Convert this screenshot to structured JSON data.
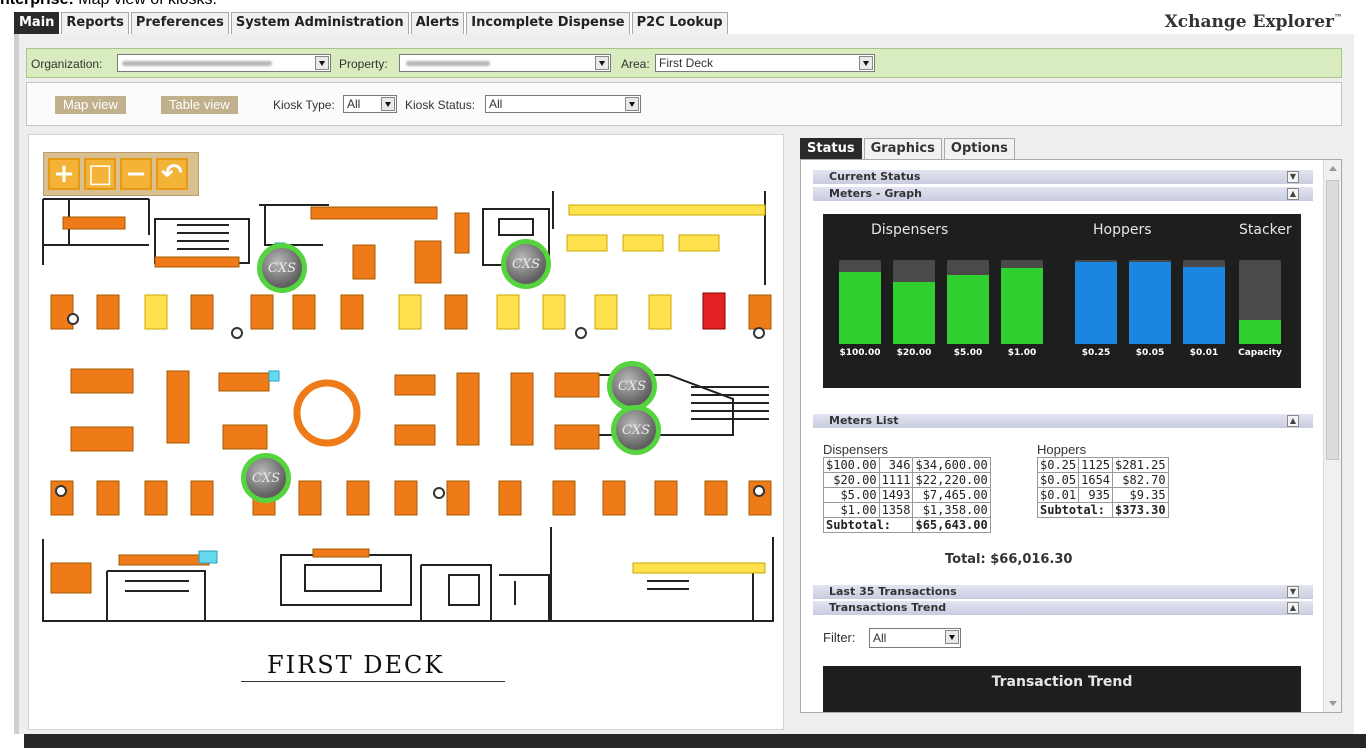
{
  "caption": {
    "bold": "nterprise:",
    "text": " Map view of kiosks."
  },
  "topnav": [
    "Main",
    "Reports",
    "Preferences",
    "System Administration",
    "Alerts",
    "Incomplete Dispense",
    "P2C Lookup"
  ],
  "brand": "Xchange Explorer",
  "brand_mark": "™",
  "orgbar": {
    "organization_label": "Organization:",
    "property_label": "Property:",
    "area_label": "Area:",
    "area_value": "First Deck"
  },
  "viewbar": {
    "map_view": "Map view",
    "table_view": "Table view",
    "kiosk_type_label": "Kiosk Type:",
    "kiosk_type_value": "All",
    "kiosk_status_label": "Kiosk Status:",
    "kiosk_status_value": "All"
  },
  "map": {
    "zoom_buttons": [
      "+",
      "□",
      "−",
      "↶"
    ],
    "kiosk_label": "CXS",
    "deck_title": "FIRST DECK"
  },
  "right_tabs": [
    "Status",
    "Graphics",
    "Options"
  ],
  "sections": {
    "current_status": "Current Status",
    "meters_graph": "Meters - Graph",
    "meters_list": "Meters List",
    "last_transactions": "Last 35 Transactions",
    "transactions_trend": "Transactions Trend"
  },
  "graph": {
    "dispensers_title": "Dispensers",
    "hoppers_title": "Hoppers",
    "stacker_title": "Stacker",
    "dispensers": [
      {
        "label": "$100.00",
        "level": 0.86
      },
      {
        "label": "$20.00",
        "level": 0.74
      },
      {
        "label": "$5.00",
        "level": 0.82
      },
      {
        "label": "$1.00",
        "level": 0.9
      }
    ],
    "hoppers": [
      {
        "label": "$0.25",
        "level": 0.98
      },
      {
        "label": "$0.05",
        "level": 0.98
      },
      {
        "label": "$0.01",
        "level": 0.92
      }
    ],
    "stacker": [
      {
        "label": "Capacity",
        "level": 0.28
      }
    ],
    "colors": {
      "dispenser": "#2fcf2f",
      "hopper": "#1a86e0",
      "stacker": "#2fcf2f"
    }
  },
  "meters_list": {
    "dispensers_caption": "Dispensers",
    "hoppers_caption": "Hoppers",
    "dispensers": [
      [
        "$100.00",
        "346",
        "$34,600.00"
      ],
      [
        "$20.00",
        "1111",
        "$22,220.00"
      ],
      [
        "$5.00",
        "1493",
        "$7,465.00"
      ],
      [
        "$1.00",
        "1358",
        "$1,358.00"
      ]
    ],
    "dispensers_subtotal_label": "Subtotal:",
    "dispensers_subtotal": "$65,643.00",
    "hoppers": [
      [
        "$0.25",
        "1125",
        "$281.25"
      ],
      [
        "$0.05",
        "1654",
        "$82.70"
      ],
      [
        "$0.01",
        "935",
        "$9.35"
      ]
    ],
    "hoppers_subtotal_label": "Subtotal:",
    "hoppers_subtotal": "$373.30",
    "total": "Total: $66,016.30"
  },
  "filter": {
    "label": "Filter:",
    "value": "All"
  },
  "trend_title": "Transaction Trend"
}
